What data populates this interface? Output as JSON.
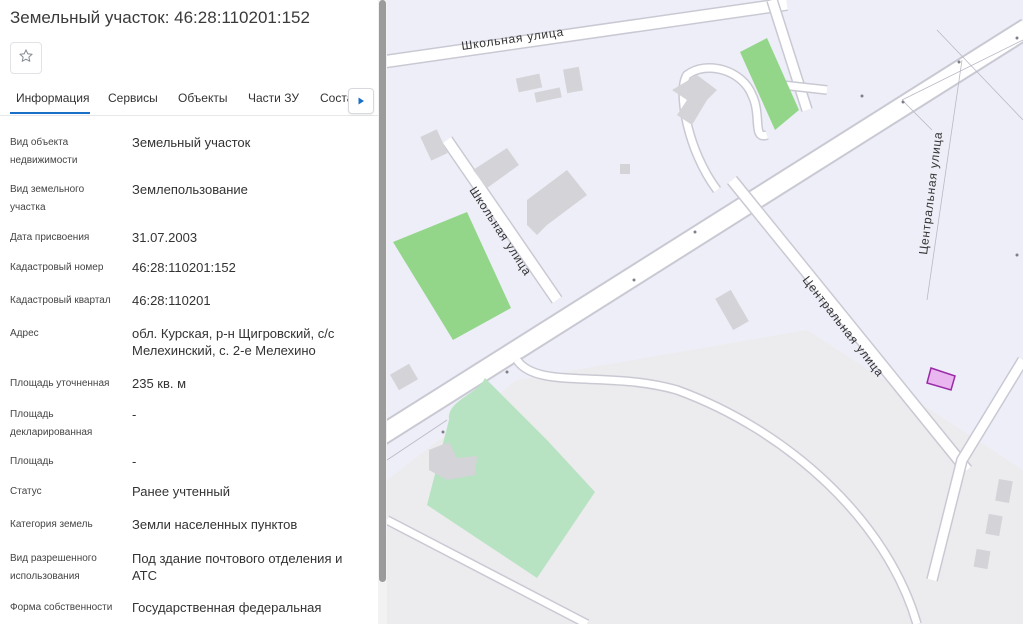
{
  "header": {
    "title": "Земельный участок: 46:28:110201:152"
  },
  "icons": {
    "favorite": "star-outline-icon",
    "tab_scroll": "triangle-right-icon"
  },
  "tabs": [
    {
      "label": "Информация",
      "active": true
    },
    {
      "label": "Сервисы",
      "active": false
    },
    {
      "label": "Объекты",
      "active": false
    },
    {
      "label": "Части ЗУ",
      "active": false
    },
    {
      "label": "Соста",
      "active": false
    }
  ],
  "info": [
    {
      "label": "Вид объекта недвижимости",
      "value": "Земельный участок"
    },
    {
      "label": "Вид земельного участка",
      "value": "Землепользование"
    },
    {
      "label": "Дата присвоения",
      "value": "31.07.2003"
    },
    {
      "label": "Кадастровый номер",
      "value": "46:28:110201:152"
    },
    {
      "label": "Кадастровый квартал",
      "value": "46:28:110201"
    },
    {
      "label": "Адрес",
      "value": "обл. Курская, р-н Щигровский, с/с Мелехинский, с. 2-е Мелехино"
    },
    {
      "label": "Площадь уточненная",
      "value": "235 кв. м"
    },
    {
      "label": "Площадь декларированная",
      "value": "-"
    },
    {
      "label": "Площадь",
      "value": "-"
    },
    {
      "label": "Статус",
      "value": "Ранее учтенный"
    },
    {
      "label": "Категория земель",
      "value": "Земли населенных пунктов"
    },
    {
      "label": "Вид разрешенного использования",
      "value": "Под здание почтового отделения и АТС"
    },
    {
      "label": "Форма собственности",
      "value": "Государственная федеральная"
    }
  ],
  "map": {
    "streets": {
      "shkolnaya_top": "Школьная улица",
      "shkolnaya_side": "Школьная улица",
      "tsentralnaya_diag": "Центральная улица",
      "tsentralnaya_vert": "Центральная улица"
    },
    "colors": {
      "background": "#eeeef8",
      "road": "#ffffff",
      "road_edge": "#c9c9d3",
      "building": "#d3d3d8",
      "green": "#93d68a",
      "green_light": "#b7e3c2",
      "parcel_fill": "#e9b6ef",
      "parcel_stroke": "#9b2aa8",
      "lower_area": "#ececee"
    }
  }
}
